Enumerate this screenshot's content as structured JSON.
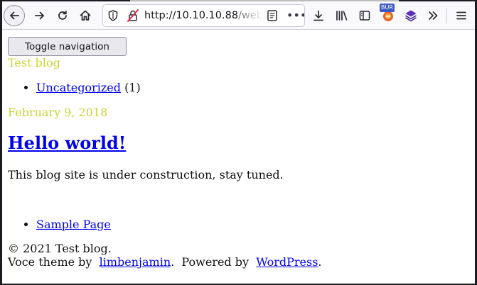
{
  "browser": {
    "url_host": "http://10.10.10.88",
    "url_rest": "/webs",
    "more_glyph": "•••",
    "burp_badge": "BUR",
    "icons": [
      "back-icon",
      "forward-icon",
      "reload-icon",
      "home-icon",
      "shield-icon",
      "insecure-lock-icon",
      "reader-view-icon",
      "page-actions-icon",
      "download-icon",
      "library-icon",
      "sidebar-icon",
      "burp-extension-icon",
      "purple-extension-icon",
      "overflow-icon",
      "hamburger-menu-icon"
    ]
  },
  "page": {
    "toggle_nav_label": "Toggle navigation",
    "site_title": "Test blog",
    "categories": [
      {
        "label": "Uncategorized",
        "count": "(1)"
      }
    ],
    "post": {
      "date": "February 9, 2018",
      "title": "Hello world!",
      "body": "This blog site is under construction, stay tuned."
    },
    "pages": [
      {
        "label": "Sample Page"
      }
    ],
    "footer": {
      "copyright": "© 2021 Test blog.",
      "theme_prefix": "Voce theme by",
      "theme_author": "limbenjamin",
      "powered_prefix": ".  Powered by",
      "powered_link": "WordPress",
      "end_period": "."
    }
  },
  "colors": {
    "accent_title": "#c8d633",
    "link": "#0000ee",
    "frame": "#1c1b22"
  }
}
